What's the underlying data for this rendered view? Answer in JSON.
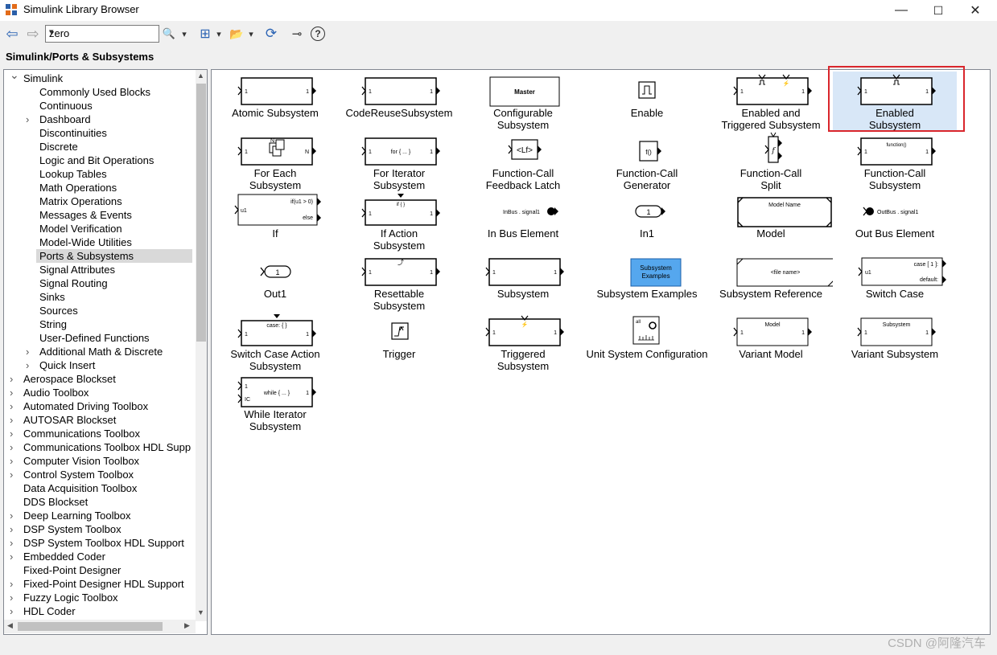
{
  "window": {
    "title": "Simulink Library Browser",
    "controls": [
      "—",
      "☐",
      "✕"
    ]
  },
  "toolbar": {
    "back_glyph": "⇦",
    "forward_glyph": "⇨",
    "search_value": "zero",
    "search_glyph": "🔍",
    "dropdown_glyph": "▾",
    "new_glyph": "⊞",
    "open_glyph": "📂",
    "refresh_glyph": "⟳",
    "pin_glyph": "⊸",
    "help_glyph": "?"
  },
  "breadcrumb": "Simulink/Ports & Subsystems",
  "tree": {
    "items": [
      {
        "label": "Simulink",
        "level": 0,
        "caret": "open"
      },
      {
        "label": "Commonly Used Blocks",
        "level": 1,
        "caret": "none"
      },
      {
        "label": "Continuous",
        "level": 1,
        "caret": "none"
      },
      {
        "label": "Dashboard",
        "level": 1,
        "caret": "closed"
      },
      {
        "label": "Discontinuities",
        "level": 1,
        "caret": "none"
      },
      {
        "label": "Discrete",
        "level": 1,
        "caret": "none"
      },
      {
        "label": "Logic and Bit Operations",
        "level": 1,
        "caret": "none"
      },
      {
        "label": "Lookup Tables",
        "level": 1,
        "caret": "none"
      },
      {
        "label": "Math Operations",
        "level": 1,
        "caret": "none"
      },
      {
        "label": "Matrix Operations",
        "level": 1,
        "caret": "none"
      },
      {
        "label": "Messages & Events",
        "level": 1,
        "caret": "none"
      },
      {
        "label": "Model Verification",
        "level": 1,
        "caret": "none"
      },
      {
        "label": "Model-Wide Utilities",
        "level": 1,
        "caret": "none"
      },
      {
        "label": "Ports & Subsystems",
        "level": 1,
        "caret": "none",
        "selected": true
      },
      {
        "label": "Signal Attributes",
        "level": 1,
        "caret": "none"
      },
      {
        "label": "Signal Routing",
        "level": 1,
        "caret": "none"
      },
      {
        "label": "Sinks",
        "level": 1,
        "caret": "none"
      },
      {
        "label": "Sources",
        "level": 1,
        "caret": "none"
      },
      {
        "label": "String",
        "level": 1,
        "caret": "none"
      },
      {
        "label": "User-Defined Functions",
        "level": 1,
        "caret": "none"
      },
      {
        "label": "Additional Math & Discrete",
        "level": 1,
        "caret": "closed"
      },
      {
        "label": "Quick Insert",
        "level": 1,
        "caret": "closed"
      },
      {
        "label": "Aerospace Blockset",
        "level": 0,
        "caret": "closed"
      },
      {
        "label": "Audio Toolbox",
        "level": 0,
        "caret": "closed"
      },
      {
        "label": "Automated Driving Toolbox",
        "level": 0,
        "caret": "closed"
      },
      {
        "label": "AUTOSAR Blockset",
        "level": 0,
        "caret": "closed"
      },
      {
        "label": "Communications Toolbox",
        "level": 0,
        "caret": "closed"
      },
      {
        "label": "Communications Toolbox HDL Supp",
        "level": 0,
        "caret": "closed"
      },
      {
        "label": "Computer Vision Toolbox",
        "level": 0,
        "caret": "closed"
      },
      {
        "label": "Control System Toolbox",
        "level": 0,
        "caret": "closed"
      },
      {
        "label": "Data Acquisition Toolbox",
        "level": 0,
        "caret": "none"
      },
      {
        "label": "DDS Blockset",
        "level": 0,
        "caret": "none"
      },
      {
        "label": "Deep Learning Toolbox",
        "level": 0,
        "caret": "closed"
      },
      {
        "label": "DSP System Toolbox",
        "level": 0,
        "caret": "closed"
      },
      {
        "label": "DSP System Toolbox HDL Support",
        "level": 0,
        "caret": "closed"
      },
      {
        "label": "Embedded Coder",
        "level": 0,
        "caret": "closed"
      },
      {
        "label": "Fixed-Point Designer",
        "level": 0,
        "caret": "none"
      },
      {
        "label": "Fixed-Point Designer HDL Support",
        "level": 0,
        "caret": "closed"
      },
      {
        "label": "Fuzzy Logic Toolbox",
        "level": 0,
        "caret": "closed"
      },
      {
        "label": "HDL Coder",
        "level": 0,
        "caret": "closed"
      }
    ]
  },
  "blocks": [
    {
      "label": "Atomic Subsystem",
      "icon": "atomic-subsystem",
      "texts": [
        "1",
        "1"
      ]
    },
    {
      "label": "CodeReuseSubsystem",
      "icon": "code-reuse-subsystem",
      "texts": [
        "1",
        "1"
      ]
    },
    {
      "label": "Configurable\nSubsystem",
      "icon": "configurable-subsystem",
      "texts": [
        "Master"
      ]
    },
    {
      "label": "Enable",
      "icon": "enable",
      "texts": []
    },
    {
      "label": "Enabled and\nTriggered Subsystem",
      "icon": "enabled-triggered-subsystem",
      "texts": [
        "1",
        "1"
      ]
    },
    {
      "label": "Enabled\nSubsystem",
      "icon": "enabled-subsystem",
      "texts": [
        "1",
        "1"
      ],
      "selected": true
    },
    {
      "label": "For Each\nSubsystem",
      "icon": "for-each-subsystem",
      "texts": [
        "1",
        "1",
        "N"
      ]
    },
    {
      "label": "For Iterator\nSubsystem",
      "icon": "for-iterator-subsystem",
      "texts": [
        "1",
        "for { ... }",
        "1"
      ]
    },
    {
      "label": "Function-Call\nFeedback Latch",
      "icon": "function-call-feedback-latch",
      "texts": [
        "<Lf>"
      ]
    },
    {
      "label": "Function-Call\nGenerator",
      "icon": "function-call-generator",
      "texts": [
        "f()"
      ]
    },
    {
      "label": "Function-Call\nSplit",
      "icon": "function-call-split",
      "texts": [
        "f"
      ]
    },
    {
      "label": "Function-Call\nSubsystem",
      "icon": "function-call-subsystem",
      "texts": [
        "function()",
        "1",
        "1"
      ]
    },
    {
      "label": "If",
      "icon": "if",
      "texts": [
        "u1",
        "if(u1 > 0)",
        "else"
      ]
    },
    {
      "label": "If Action\nSubsystem",
      "icon": "if-action-subsystem",
      "texts": [
        "if { }",
        "1",
        "1"
      ]
    },
    {
      "label": "In Bus Element",
      "icon": "in-bus-element",
      "texts": [
        "InBus . signal1"
      ]
    },
    {
      "label": "In1",
      "icon": "in1",
      "texts": [
        "1"
      ]
    },
    {
      "label": "Model",
      "icon": "model",
      "texts": [
        "Model Name"
      ]
    },
    {
      "label": "Out Bus Element",
      "icon": "out-bus-element",
      "texts": [
        "OutBus . signal1"
      ]
    },
    {
      "label": "Out1",
      "icon": "out1",
      "texts": [
        "1"
      ]
    },
    {
      "label": "Resettable\nSubsystem",
      "icon": "resettable-subsystem",
      "texts": [
        "1",
        "1"
      ]
    },
    {
      "label": "Subsystem",
      "icon": "subsystem",
      "texts": [
        "1",
        "1"
      ]
    },
    {
      "label": "Subsystem Examples",
      "icon": "subsystem-examples",
      "texts": [
        "Subsystem",
        "Examples"
      ]
    },
    {
      "label": "Subsystem Reference",
      "icon": "subsystem-reference",
      "texts": [
        "<file name>"
      ]
    },
    {
      "label": "Switch Case",
      "icon": "switch-case",
      "texts": [
        "u1",
        "case [ 1 ]:",
        "default:"
      ]
    },
    {
      "label": "Switch Case Action\nSubsystem",
      "icon": "switch-case-action-subsystem",
      "texts": [
        "case: { }",
        "1",
        "1"
      ]
    },
    {
      "label": "Trigger",
      "icon": "trigger",
      "texts": []
    },
    {
      "label": "Triggered\nSubsystem",
      "icon": "triggered-subsystem",
      "texts": [
        "1",
        "1"
      ]
    },
    {
      "label": "Unit System Configuration",
      "icon": "unit-system-configuration",
      "texts": [
        "all"
      ]
    },
    {
      "label": "Variant Model",
      "icon": "variant-model",
      "texts": [
        "Model",
        "1",
        "1"
      ]
    },
    {
      "label": "Variant Subsystem",
      "icon": "variant-subsystem",
      "texts": [
        "Subsystem",
        "1",
        "1"
      ]
    },
    {
      "label": "While Iterator\nSubsystem",
      "icon": "while-iterator-subsystem",
      "texts": [
        "1",
        "IC",
        "while { ... }",
        "1"
      ]
    }
  ],
  "scroll": {
    "up": "▲",
    "down": "▼",
    "left": "◀",
    "right": "▶"
  },
  "watermark": "CSDN @阿隆汽车"
}
